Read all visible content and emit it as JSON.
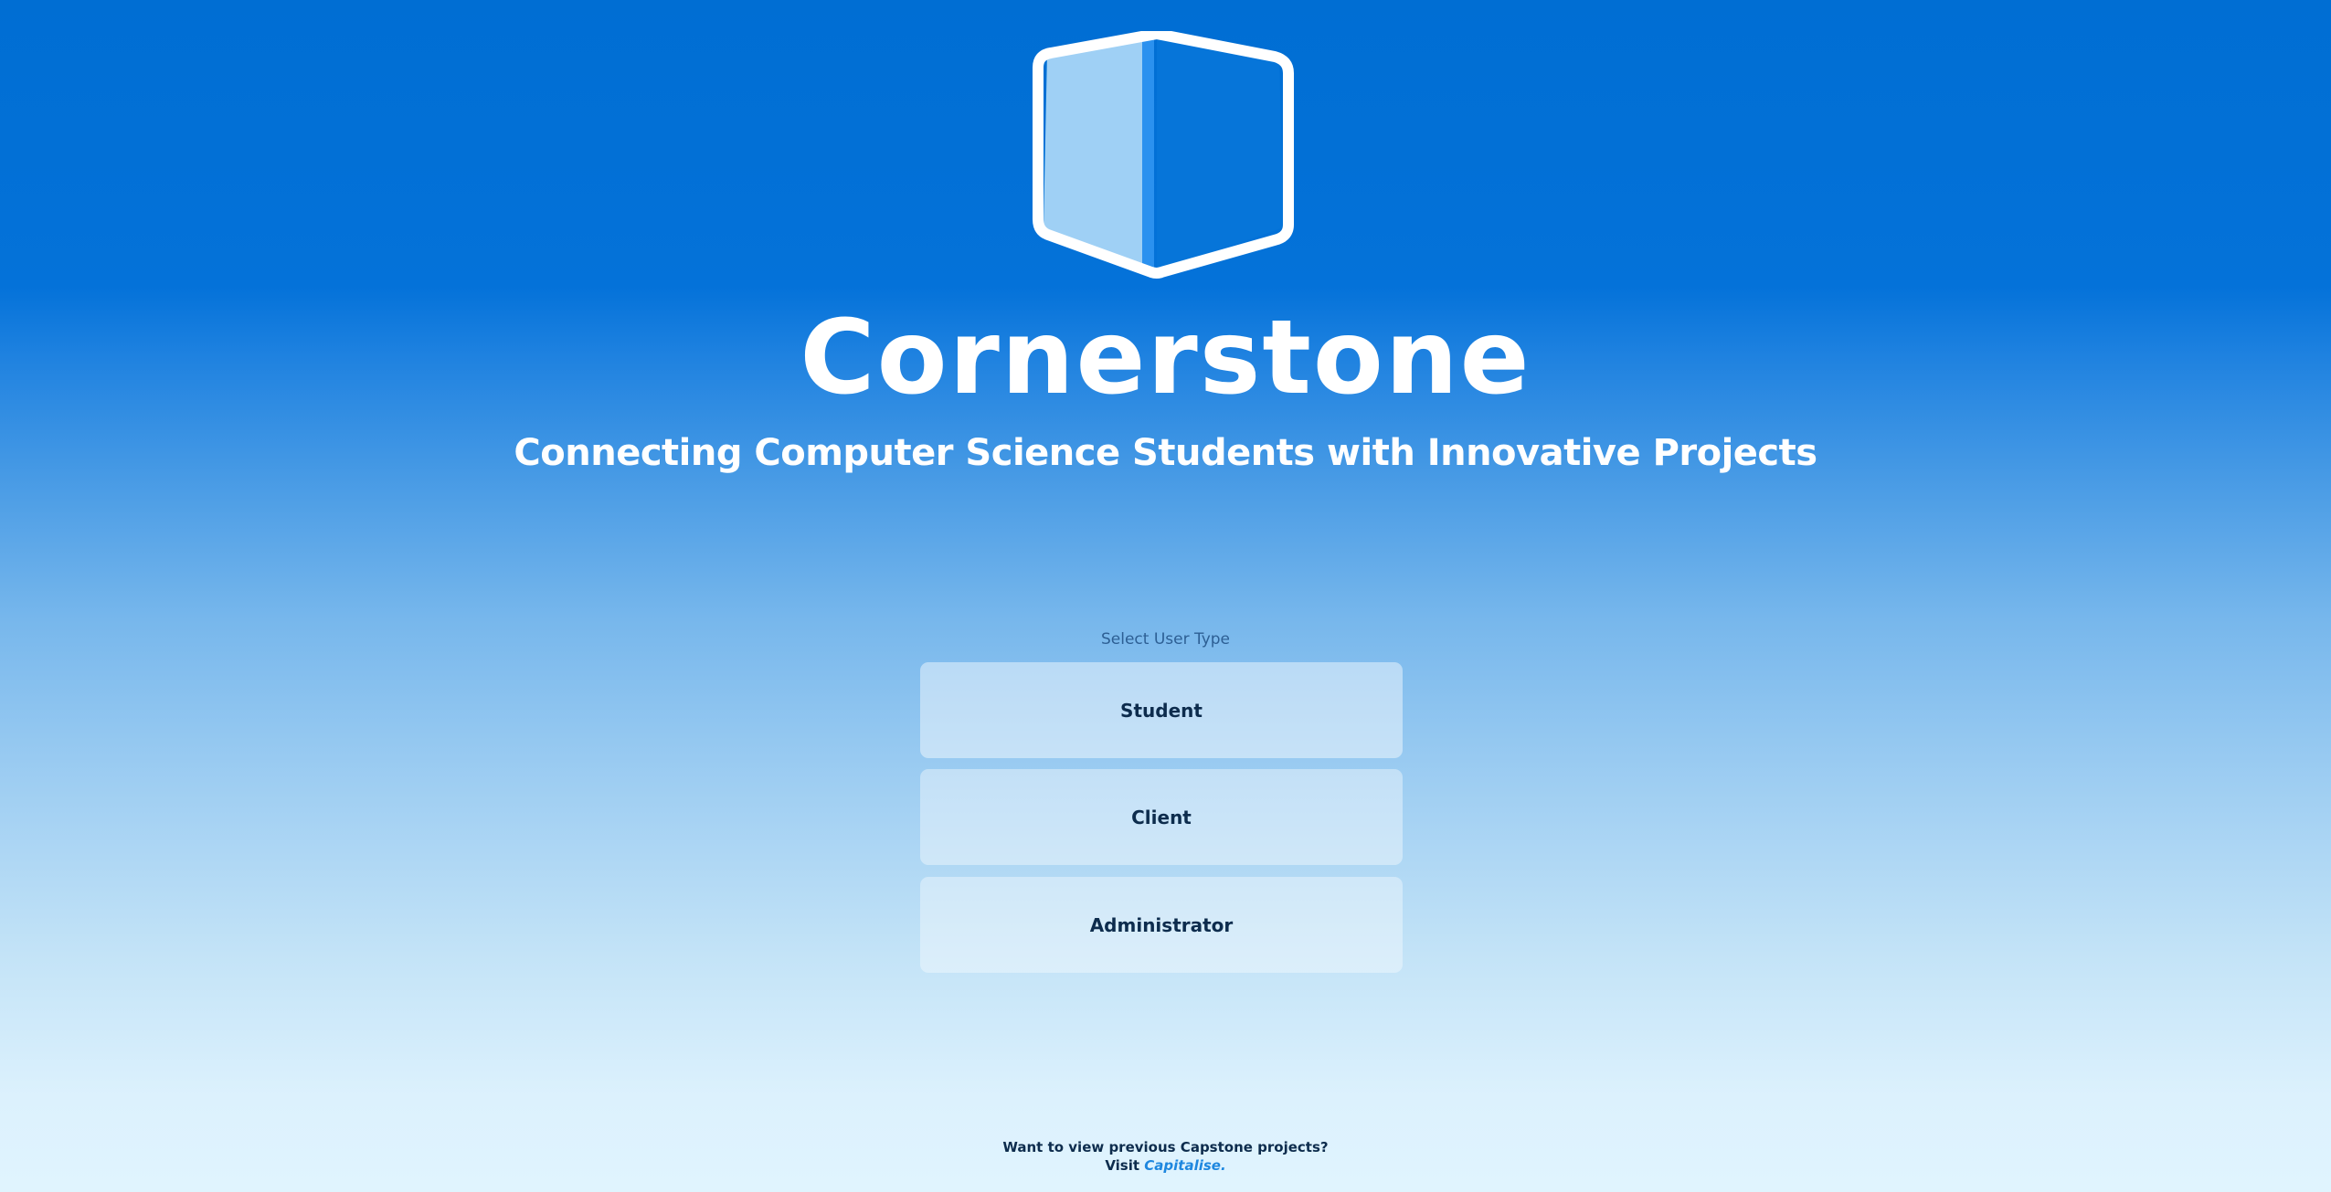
{
  "app": {
    "title": "Cornerstone",
    "tagline": "Connecting Computer Science Students with Innovative Projects"
  },
  "logo": {
    "icon": "cube-logo-icon",
    "colors": {
      "outline": "#ffffff",
      "left_face": "#9fd0f5",
      "divider": "#2b91ef",
      "right_face": "#0675d9"
    }
  },
  "user_select": {
    "label": "Select User Type",
    "options": [
      {
        "label": "Student"
      },
      {
        "label": "Client"
      },
      {
        "label": "Administrator"
      }
    ]
  },
  "footer": {
    "prompt": "Want to view previous Capstone projects?",
    "visit_text": "Visit",
    "link_text": "Capitalise."
  },
  "colors": {
    "background_top": "#006ed3",
    "background_bottom": "#e0f4fe",
    "text_dark": "#0d2c4d",
    "link": "#1e87df"
  }
}
